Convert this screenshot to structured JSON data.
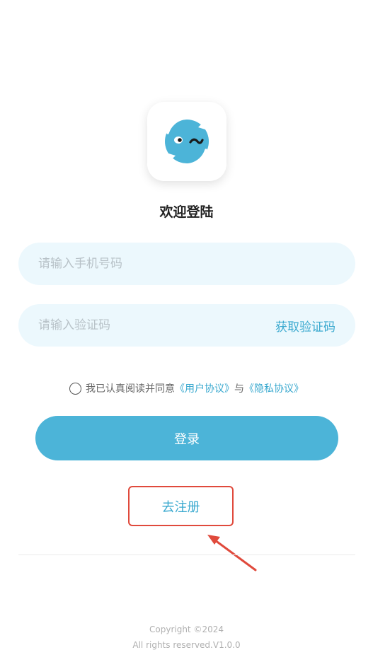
{
  "colors": {
    "accent": "#4cb4d8",
    "link": "#3aa9cf",
    "field_bg": "#ecf8fd",
    "annotation": "#e04a3c"
  },
  "logo": {
    "icon": "winking-face-refresh-icon"
  },
  "welcome": {
    "title": "欢迎登陆"
  },
  "form": {
    "phone_placeholder": "请输入手机号码",
    "phone_value": "",
    "code_placeholder": "请输入验证码",
    "code_value": "",
    "get_code_label": "获取验证码"
  },
  "agreement": {
    "checked": false,
    "prefix": "我已认真阅读并同意",
    "user_agreement": "《用户协议》",
    "conjunction": "与",
    "privacy_policy": "《隐私协议》"
  },
  "actions": {
    "login_label": "登录",
    "register_label": "去注册"
  },
  "footer": {
    "copyright": "Copyright ©2024",
    "rights": "All rights reserved.V1.0.0"
  }
}
